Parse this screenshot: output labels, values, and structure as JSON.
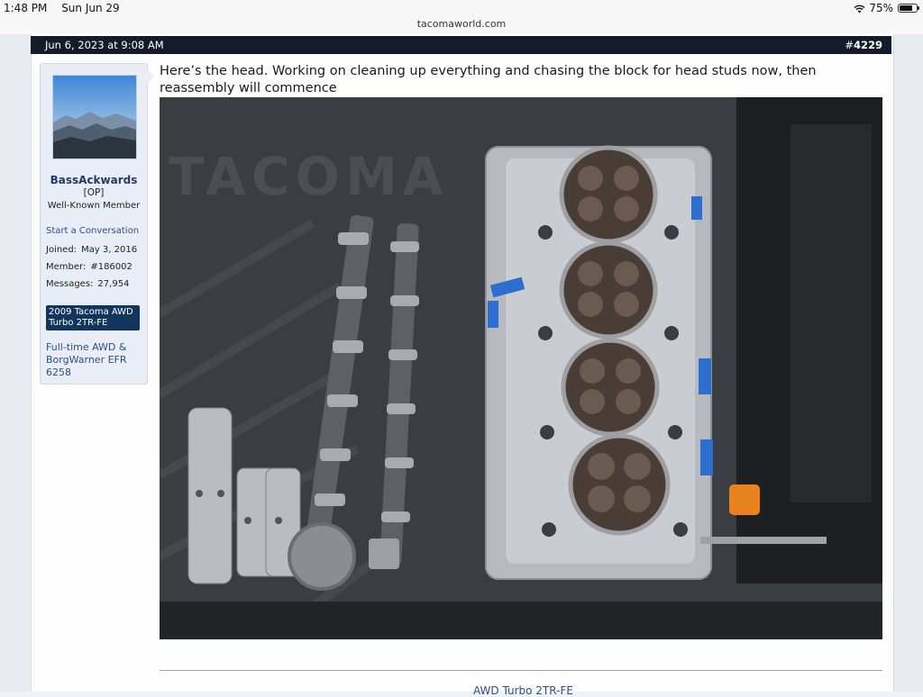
{
  "status_bar": {
    "time": "1:48 PM",
    "date": "Sun Jun 29",
    "battery": "75%",
    "battery_level": 0.75
  },
  "browser": {
    "url": "tacomaworld.com"
  },
  "post": {
    "timestamp": "Jun 6, 2023 at 9:08 AM",
    "number_prefix": "#",
    "number": "4229",
    "body": "Here’s the head. Working on cleaning up everything and chasing the block for head studs now, then reassembly will commence"
  },
  "user": {
    "name": "BassAckwards",
    "op_tag": "[OP]",
    "rank": "Well-Known Member",
    "start_conversation": "Start a Conversation",
    "stats": [
      {
        "label": "Joined:",
        "value": "May 3, 2016"
      },
      {
        "label": "Member:",
        "value": "#186002"
      },
      {
        "label": "Messages:",
        "value": "27,954"
      }
    ],
    "vehicle": "2009 Tacoma AWD Turbo 2TR-FE",
    "vehicle_desc": "Full-time AWD & BorgWarner EFR 6258"
  },
  "signature": {
    "link": "AWD Turbo 2TR-FE"
  },
  "icons": {
    "wifi": "wifi-icon",
    "battery": "battery-icon"
  },
  "colors": {
    "header_bg": "#141c2b",
    "link": "#2a4f8a",
    "badge_bg": "#12355e"
  }
}
